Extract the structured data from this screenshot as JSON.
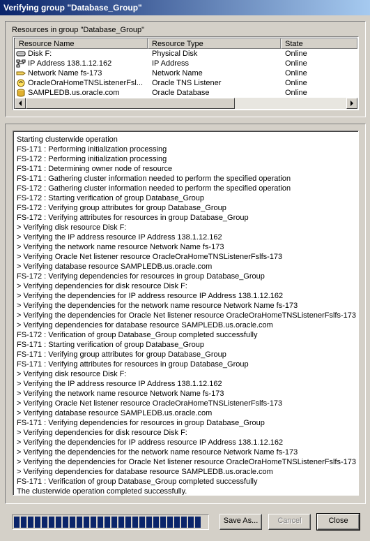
{
  "window": {
    "title": "Verifying group \"Database_Group\""
  },
  "resources": {
    "group_label": "Resources in group \"Database_Group\"",
    "columns": [
      "Resource Name",
      "Resource Type",
      "State"
    ],
    "rows": [
      {
        "name": "Disk F:",
        "type": "Physical Disk",
        "state": "Online",
        "icon": "disk-icon"
      },
      {
        "name": "IP Address 138.1.12.162",
        "type": "IP Address",
        "state": "Online",
        "icon": "network-icon"
      },
      {
        "name": "Network Name fs-173",
        "type": "Network Name",
        "state": "Online",
        "icon": "network-name-icon"
      },
      {
        "name": "OracleOraHomeTNSListenerFsl...",
        "type": "Oracle TNS Listener",
        "state": "Online",
        "icon": "oracle-listener-icon"
      },
      {
        "name": "SAMPLEDB.us.oracle.com",
        "type": "Oracle Database",
        "state": "Online",
        "icon": "database-icon"
      }
    ]
  },
  "log": {
    "lines": [
      "Starting clusterwide operation",
      "FS-171 : Performing initialization processing",
      "FS-172 : Performing initialization processing",
      "FS-171 : Determining owner node of resource",
      "FS-171 : Gathering cluster information needed to perform the specified operation",
      "FS-172 : Gathering cluster information needed to perform the specified operation",
      "FS-172 : Starting verification of group Database_Group",
      "FS-172 : Verifying group attributes for group Database_Group",
      "FS-172 : Verifying attributes for resources in group Database_Group",
      " > Verifying disk resource Disk F:",
      " > Verifying the IP address resource IP Address 138.1.12.162",
      " > Verifying the network name resource Network Name fs-173",
      " > Verifying Oracle Net listener resource OracleOraHomeTNSListenerFslfs-173",
      " > Verifying database resource SAMPLEDB.us.oracle.com",
      "FS-172 : Verifying dependencies for resources in group Database_Group",
      " > Verifying dependencies for disk resource Disk F:",
      " > Verifying the dependencies for IP address resource IP Address 138.1.12.162",
      " > Verifying the dependencies for the network name resource Network Name fs-173",
      " > Verifying the dependencies for Oracle Net listener resource OracleOraHomeTNSListenerFslfs-173",
      " > Verifying dependencies for database resource SAMPLEDB.us.oracle.com",
      "FS-172 : Verification of group Database_Group completed successfully",
      "FS-171 : Starting verification of group Database_Group",
      "FS-171 : Verifying group attributes for group Database_Group",
      "FS-171 : Verifying attributes for resources in group Database_Group",
      " > Verifying disk resource Disk F:",
      " > Verifying the IP address resource IP Address 138.1.12.162",
      " > Verifying the network name resource Network Name fs-173",
      " > Verifying Oracle Net listener resource OracleOraHomeTNSListenerFslfs-173",
      " > Verifying database resource SAMPLEDB.us.oracle.com",
      "FS-171 : Verifying dependencies for resources in group Database_Group",
      " > Verifying dependencies for disk resource Disk F:",
      " > Verifying the dependencies for IP address resource IP Address 138.1.12.162",
      " > Verifying the dependencies for the network name resource Network Name fs-173",
      " > Verifying the dependencies for Oracle Net listener resource OracleOraHomeTNSListenerFslfs-173",
      " > Verifying dependencies for database resource SAMPLEDB.us.oracle.com",
      "FS-171 : Verification of group Database_Group completed successfully",
      "The clusterwide operation completed successfully."
    ]
  },
  "progress": {
    "fraction": 1.0
  },
  "buttons": {
    "save_as": "Save As...",
    "cancel": "Cancel",
    "close": "Close"
  },
  "colors": {
    "title_start": "#0a246a",
    "title_end": "#a6caf0",
    "progress": "#0a246a",
    "face": "#d4d0c8"
  }
}
